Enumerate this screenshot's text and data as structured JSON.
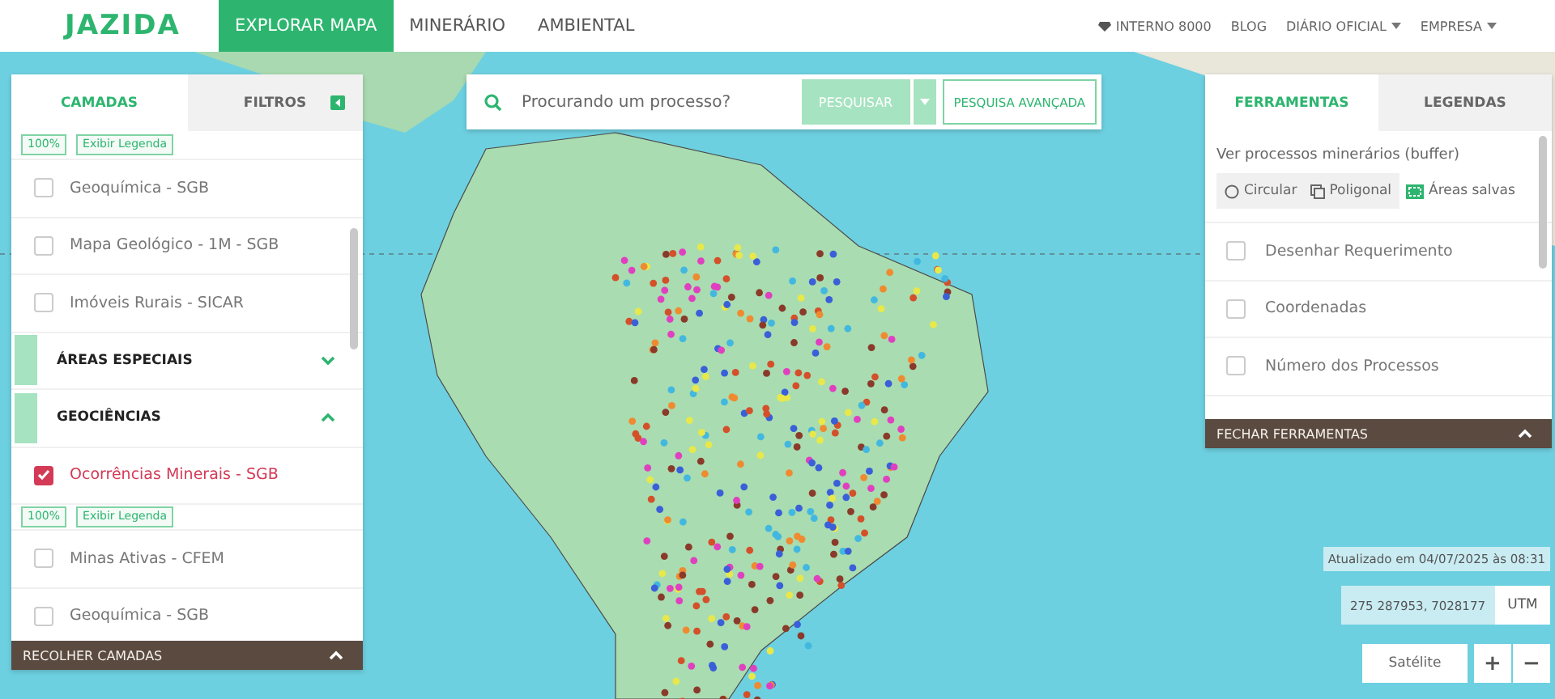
{
  "nav": {
    "logo": "JAZIDA",
    "tabs": [
      {
        "label": "EXPLORAR MAPA",
        "selected": true
      },
      {
        "label": "MINERÁRIO",
        "selected": false
      },
      {
        "label": "AMBIENTAL",
        "selected": false
      }
    ],
    "links": [
      {
        "label": "INTERNO 8000",
        "kind": "gem",
        "dropdown": false
      },
      {
        "label": "BLOG",
        "kind": "plain",
        "dropdown": false
      },
      {
        "label": "DIÁRIO OFICIAL",
        "kind": "plain",
        "dropdown": true
      },
      {
        "label": "EMPRESA",
        "kind": "plain",
        "dropdown": true
      }
    ]
  },
  "left_panel": {
    "tabs": [
      {
        "label": "CAMADAS",
        "selected": true
      },
      {
        "label": "FILTROS",
        "selected": false
      }
    ],
    "items": [
      {
        "kind": "controls",
        "opacity": "100%",
        "legend": "Exibir Legenda"
      },
      {
        "kind": "layer",
        "label": "Geoquímica - SGB",
        "checked": false
      },
      {
        "kind": "layer",
        "label": "Mapa Geológico - 1M - SGB",
        "checked": false
      },
      {
        "kind": "layer",
        "label": "Imóveis Rurais - SICAR",
        "checked": false
      },
      {
        "kind": "group",
        "label": "ÁREAS ESPECIAIS",
        "expanded": false
      },
      {
        "kind": "group",
        "label": "GEOCIÊNCIAS",
        "expanded": true
      },
      {
        "kind": "layer",
        "label": "Ocorrências Minerais - SGB",
        "checked": true
      },
      {
        "kind": "controls",
        "opacity": "100%",
        "legend": "Exibir Legenda"
      },
      {
        "kind": "layer",
        "label": "Minas Ativas - CFEM",
        "checked": false
      },
      {
        "kind": "layer",
        "label": "Geoquímica - SGB",
        "checked": false
      }
    ],
    "footer": "RECOLHER CAMADAS"
  },
  "search": {
    "placeholder": "Procurando um processo?",
    "button": "PESQUISAR",
    "advanced": "PESQUISA AVANÇADA"
  },
  "right_panel": {
    "tabs": [
      {
        "label": "FERRAMENTAS",
        "selected": true
      },
      {
        "label": "LEGENDAS",
        "selected": false
      }
    ],
    "buffer_label": "Ver processos minerários (buffer)",
    "buffer_options": [
      {
        "kind": "circle",
        "label": "Circular"
      },
      {
        "kind": "polygon",
        "label": "Poligonal"
      },
      {
        "kind": "saved",
        "label": "Áreas salvas"
      }
    ],
    "tools": [
      {
        "label": "Desenhar Requerimento",
        "checked": false
      },
      {
        "label": "Coordenadas",
        "checked": false
      },
      {
        "label": "Número dos Processos",
        "checked": false
      }
    ],
    "footer": "FECHAR FERRAMENTAS"
  },
  "updated": "Atualizado em 04/07/2025 às 08:31",
  "coordinates": {
    "value": "275 287953, 7028177",
    "unit": "UTM"
  },
  "layer_button": "Satélite",
  "zoom": [
    "+",
    "−"
  ]
}
